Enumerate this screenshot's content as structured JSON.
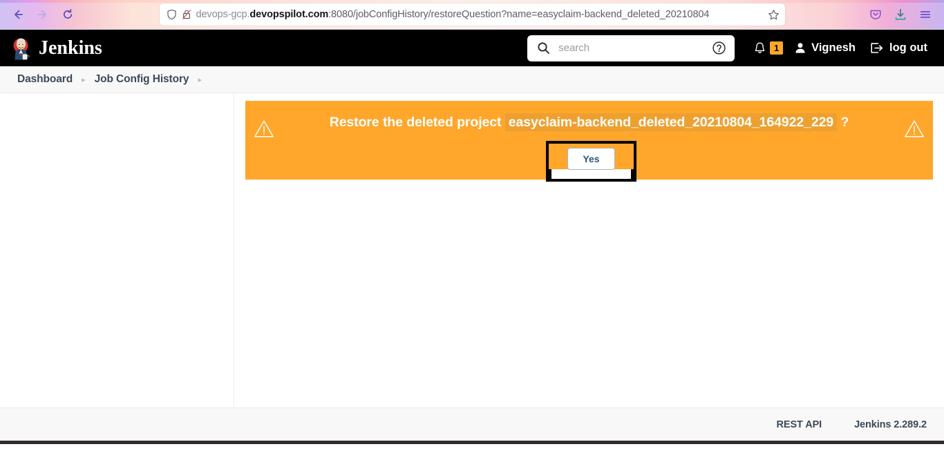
{
  "browser": {
    "back_icon": "back-arrow-icon",
    "forward_icon": "forward-arrow-icon",
    "reload_icon": "reload-icon",
    "shield_icon": "shield-icon",
    "lock_icon": "lock-broken-icon",
    "url_prefix": "devops-gcp.",
    "url_host": "devopspilot.com",
    "url_path": ":8080/jobConfigHistory/restoreQuestion?name=easyclaim-backend_deleted_20210804",
    "url_full": "devops-gcp.devopspilot.com:8080/jobConfigHistory/restoreQuestion?name=easyclaim-backend_deleted_20210804",
    "star_icon": "bookmark-star-icon",
    "pocket_icon": "pocket-icon",
    "downloads_icon": "downloads-icon",
    "menu_icon": "hamburger-menu-icon"
  },
  "header": {
    "logo_icon": "jenkins-butler-logo",
    "title": "Jenkins",
    "search": {
      "placeholder": "search",
      "value": "",
      "search_icon": "search-icon",
      "help_icon": "help-circle-icon"
    },
    "notifications": {
      "bell_icon": "bell-icon",
      "count": "1"
    },
    "user": {
      "person_icon": "person-icon",
      "name": "Vignesh"
    },
    "logout": {
      "logout_icon": "logout-arrow-icon",
      "label": "log out"
    }
  },
  "breadcrumb": {
    "items": [
      {
        "label": "Dashboard"
      },
      {
        "label": "Job Config History"
      }
    ],
    "separator": "▸"
  },
  "alert": {
    "warning_icon_left": "warning-triangle-icon",
    "warning_icon_right": "warning-triangle-icon",
    "message_prefix": "Restore the deleted project",
    "project_name": "easyclaim-backend_deleted_20210804_164922_229",
    "message_suffix": "?",
    "confirm_label": "Yes",
    "background_color": "#ffa62b",
    "project_name_bg": "#eda030"
  },
  "footer": {
    "rest_api_label": "REST API",
    "version_label": "Jenkins 2.289.2"
  }
}
